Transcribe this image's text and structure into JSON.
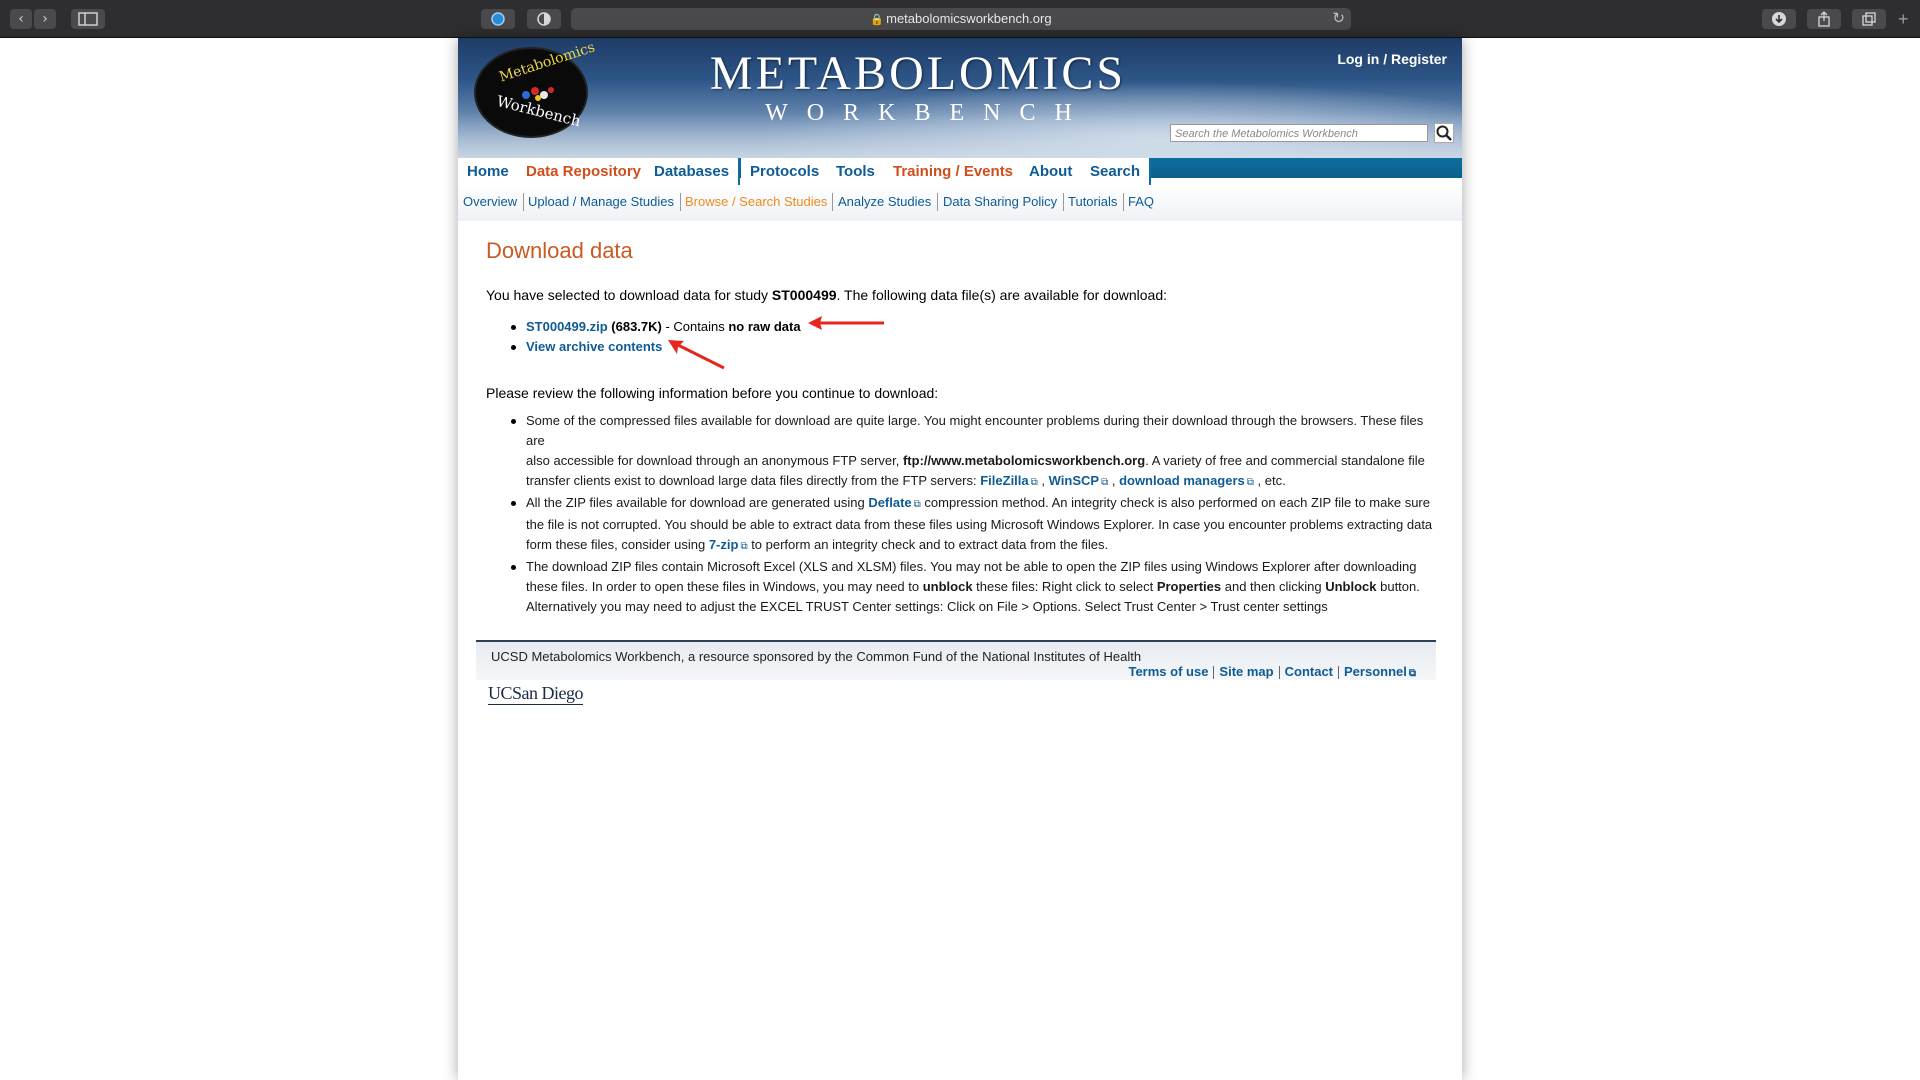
{
  "browser": {
    "url": "metabolomicsworkbench.org"
  },
  "header": {
    "logo_top": "Metabolomics",
    "logo_bottom": "Workbench",
    "title": "METABOLOMICS",
    "subtitle": "WORKBENCH",
    "login": "Log in / Register",
    "search_placeholder": "Search the Metabolomics Workbench"
  },
  "mainnav": {
    "items": [
      "Home",
      "Data Repository",
      "Databases",
      "Protocols",
      "Tools",
      "Training / Events",
      "About",
      "Search"
    ],
    "active": [
      "Data Repository",
      "Training / Events"
    ]
  },
  "subnav": {
    "items": [
      "Overview",
      "Upload / Manage Studies",
      "Browse / Search Studies",
      "Analyze Studies",
      "Data Sharing Policy",
      "Tutorials",
      "FAQ"
    ],
    "active": "Browse / Search Studies"
  },
  "main": {
    "heading": "Download data",
    "intro_a": "You have selected to download data for study ",
    "study_id": "ST000499",
    "intro_b": ". The following data file(s) are available for download:",
    "file_link": "ST000499.zip",
    "file_size": "(683.7K)",
    "file_note": " - Contains ",
    "file_note_bold": "no raw data",
    "archive_link": "View archive contents",
    "review": "Please review the following information before you continue to download:",
    "note1": {
      "a": "Some of the compressed files available for download are quite large. You might encounter problems during their download through the browsers. These files are",
      "b": "also accessible for download through an anonymous FTP server, ",
      "ftp": "ftp://www.metabolomicsworkbench.org",
      "c": ". A variety of free and commercial standalone file",
      "d": "transfer clients exist to download large data files directly from the FTP servers: ",
      "filezilla": "FileZilla",
      "winscp": "WinSCP",
      "dlm": "download managers",
      "e": " , etc."
    },
    "note2": {
      "a": "All the ZIP files available for download are generated using ",
      "deflate": "Deflate",
      "b": " compression method. An integrity check is also performed on each ZIP file to make sure",
      "c": "the file is not corrupted. You should be able to extract data from these files using Microsoft Windows Explorer. In case you encounter problems extracting data",
      "d": "form these files, consider using ",
      "sevenzip": "7-zip",
      "e": " to perform an integrity check and to extract data from the files."
    },
    "note3": {
      "a": "The download ZIP files contain Microsoft Excel (XLS and XLSM) files. You may not be able to open the ZIP files using Windows Explorer after downloading",
      "b": "these files. In order to open these files in Windows, you may need to ",
      "unblock": "unblock",
      "c": " these files: Right click to select ",
      "properties": "Properties",
      "d": " and then clicking ",
      "unblock_btn": "Unblock",
      "e": " button.",
      "f": "Alternatively you may need to adjust the EXCEL TRUST Center settings: Click on File > Options. Select Trust Center > Trust center settings"
    }
  },
  "footer": {
    "sponsor": "UCSD Metabolomics Workbench, a resource sponsored by the Common Fund of the National Institutes of Health",
    "links": [
      "Terms of use",
      "Site map",
      "Contact",
      "Personnel"
    ],
    "ucsd": "UCSan Diego"
  },
  "colors": {
    "link": "#0e5b96",
    "heading": "#c95a22",
    "annotation_arrow": "#e8261c"
  }
}
